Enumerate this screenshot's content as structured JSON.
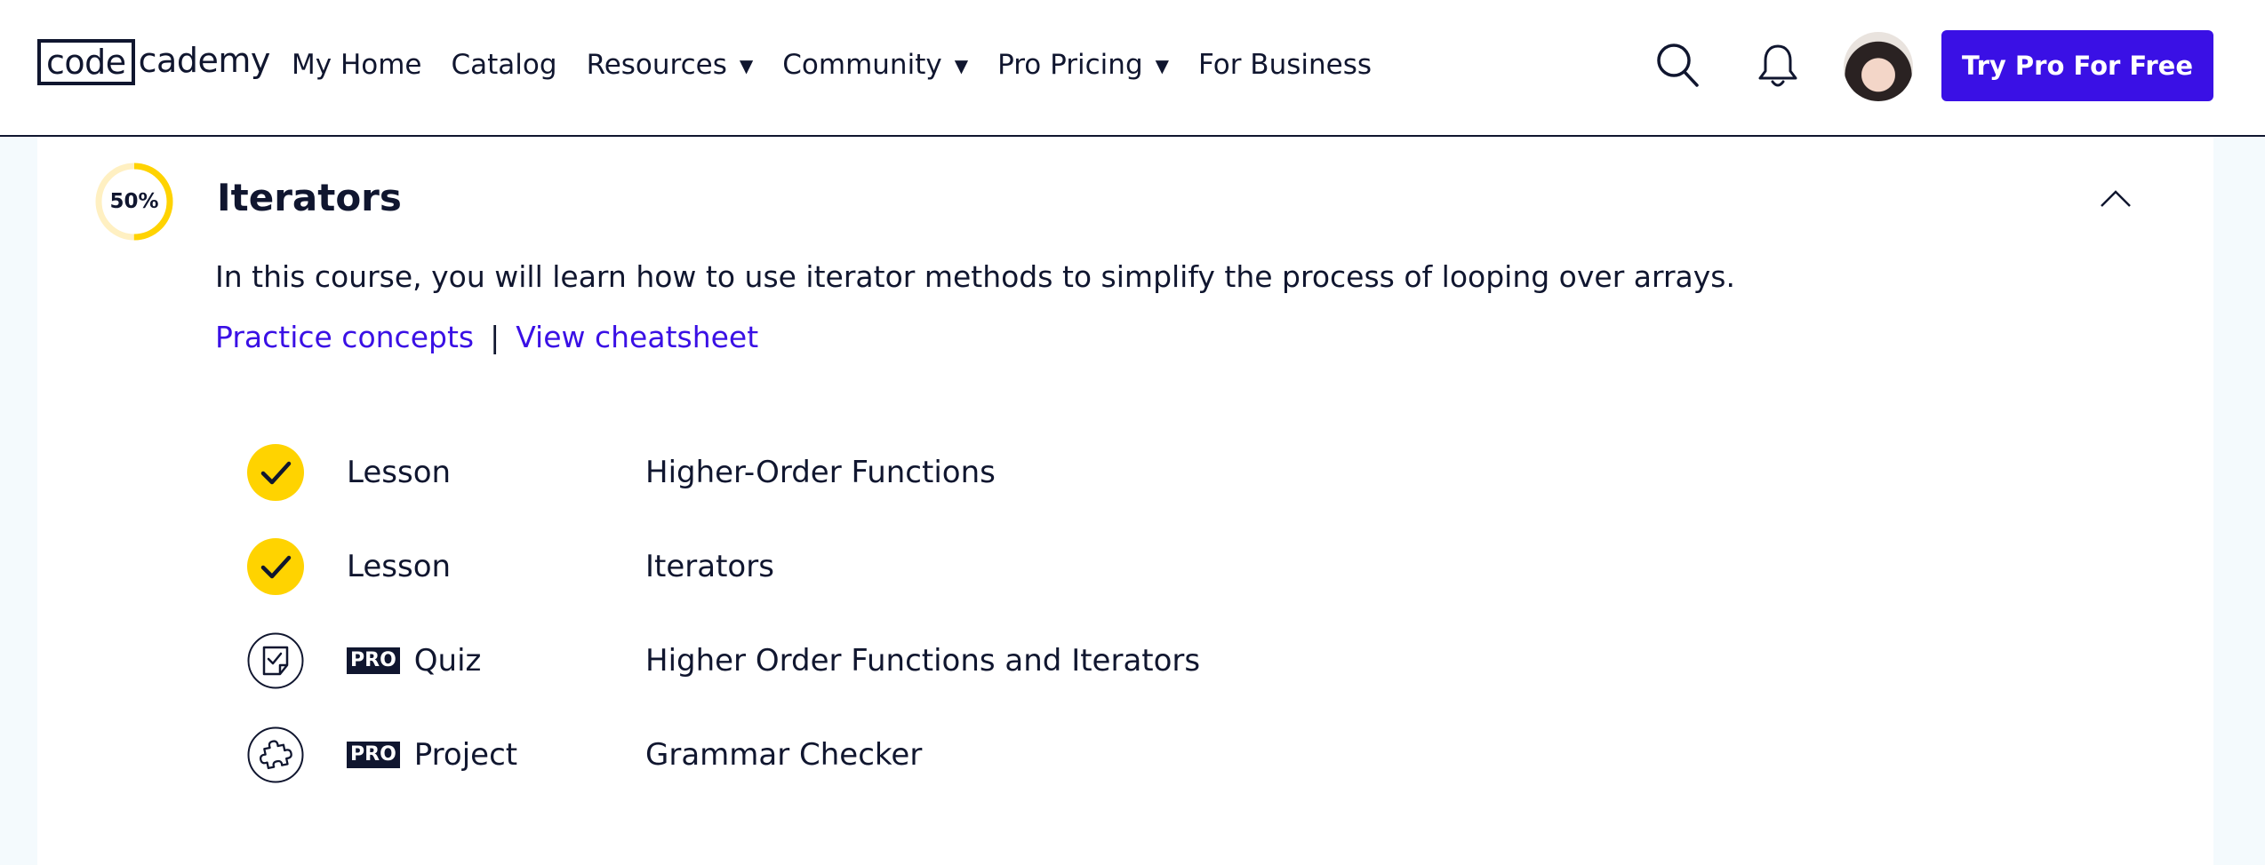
{
  "header": {
    "logo": {
      "boxed": "code",
      "rest": "cademy"
    },
    "nav": [
      {
        "label": "My Home",
        "dropdown": false
      },
      {
        "label": "Catalog",
        "dropdown": false
      },
      {
        "label": "Resources",
        "dropdown": true
      },
      {
        "label": "Community",
        "dropdown": true
      },
      {
        "label": "Pro Pricing",
        "dropdown": true
      },
      {
        "label": "For Business",
        "dropdown": false
      }
    ],
    "caret": "▼",
    "icons": [
      "search-icon",
      "bell-icon"
    ],
    "cta_label": "Try Pro For Free"
  },
  "course": {
    "progress_label": "50%",
    "progress": 0.5,
    "title": "Iterators",
    "description": "In this course, you will learn how to use iterator methods to simplify the process of looping over arrays.",
    "links": {
      "practice": "Practice concepts",
      "separator": "|",
      "cheatsheet": "View cheatsheet"
    },
    "items": [
      {
        "status": "completed",
        "icon": "check-icon",
        "pro": false,
        "kind": "Lesson",
        "title": "Higher-Order Functions"
      },
      {
        "status": "completed",
        "icon": "check-icon",
        "pro": false,
        "kind": "Lesson",
        "title": "Iterators"
      },
      {
        "status": "pending",
        "icon": "quiz-icon",
        "pro": true,
        "pro_label": "PRO",
        "kind": "Quiz",
        "title": "Higher Order Functions and Iterators"
      },
      {
        "status": "pending",
        "icon": "puzzle-icon",
        "pro": true,
        "pro_label": "PRO",
        "kind": "Project",
        "title": "Grammar Checker"
      }
    ]
  },
  "colors": {
    "brand": "#3a10e5",
    "navy": "#10162f",
    "complete": "#ffd300",
    "ring_track": "#fff0c2"
  }
}
